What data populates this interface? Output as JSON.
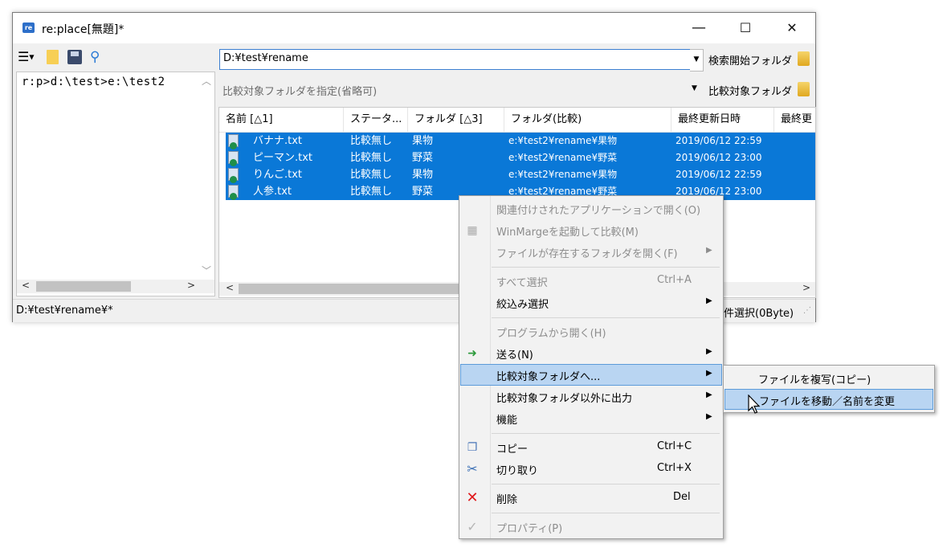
{
  "window": {
    "title": "re:place[無題]*",
    "app_icon": "app-icon",
    "minimize_glyph": "—",
    "maximize_glyph": "☐",
    "close_glyph": "✕"
  },
  "left_pane": {
    "command_line": "r:p>d:\\test>e:\\test2",
    "toolbar_icons": [
      "menu-icon",
      "new-file-icon",
      "save-icon",
      "search-icon"
    ]
  },
  "search_path": {
    "value": "D:¥test¥rename",
    "button_label": "検索開始フォルダ"
  },
  "compare_path": {
    "placeholder": "比較対象フォルダを指定(省略可)",
    "button_label": "比較対象フォルダ"
  },
  "file_list": {
    "columns": [
      "名前 [△1]",
      "ステータ...",
      "フォルダ [△3]",
      "フォルダ(比較)",
      "最終更新日時",
      "最終更"
    ],
    "rows": [
      {
        "name": "バナナ.txt",
        "status": "比較無し",
        "folder": "果物",
        "compare_folder": "e:¥test2¥rename¥果物",
        "modified": "2019/06/12 22:59"
      },
      {
        "name": "ピーマン.txt",
        "status": "比較無し",
        "folder": "野菜",
        "compare_folder": "e:¥test2¥rename¥野菜",
        "modified": "2019/06/12 23:00"
      },
      {
        "name": "りんご.txt",
        "status": "比較無し",
        "folder": "果物",
        "compare_folder": "e:¥test2¥rename¥果物",
        "modified": "2019/06/12 22:59"
      },
      {
        "name": "人参.txt",
        "status": "比較無し",
        "folder": "野菜",
        "compare_folder": "e:¥test2¥rename¥野菜",
        "modified": "2019/06/12 23:00"
      }
    ],
    "selection_color": "#0a78d7"
  },
  "status_bar": {
    "path": "D:¥test¥rename¥*",
    "selection_info": "件選択(0Byte)"
  },
  "context_menu": {
    "items": [
      {
        "label": "関連付けされたアプリケーションで開く(O)",
        "disabled": true
      },
      {
        "label": "WinMargeを起動して比較(M)",
        "disabled": true,
        "icon": "winmerge-icon"
      },
      {
        "label": "ファイルが存在するフォルダを開く(F)",
        "disabled": true
      },
      {
        "label": "すべて選択",
        "shortcut": "Ctrl+A",
        "disabled": true
      },
      {
        "label": "絞込み選択"
      },
      {
        "label": "プログラムから開く(H)",
        "disabled": true
      },
      {
        "label": "送る(N)",
        "icon": "send-to-icon"
      },
      {
        "label": "比較対象フォルダへ...",
        "highlighted": true
      },
      {
        "label": "比較対象フォルダ以外に出力"
      },
      {
        "label": "機能"
      },
      {
        "label": "コピー",
        "shortcut": "Ctrl+C",
        "icon": "copy-icon"
      },
      {
        "label": "切り取り",
        "shortcut": "Ctrl+X",
        "icon": "cut-icon"
      },
      {
        "label": "削除",
        "shortcut": "Del",
        "icon": "delete-icon"
      },
      {
        "label": "プロパティ(P)",
        "disabled": true,
        "icon": "check-icon"
      }
    ]
  },
  "submenu": {
    "items": [
      {
        "label": "ファイルを複写(コピー)"
      },
      {
        "label": "ファイルを移動／名前を変更",
        "highlighted": true
      }
    ]
  },
  "colors": {
    "accent": "#0a78d7",
    "menu_highlight": "#b9d5f2",
    "delete_red": "#e0191c"
  }
}
